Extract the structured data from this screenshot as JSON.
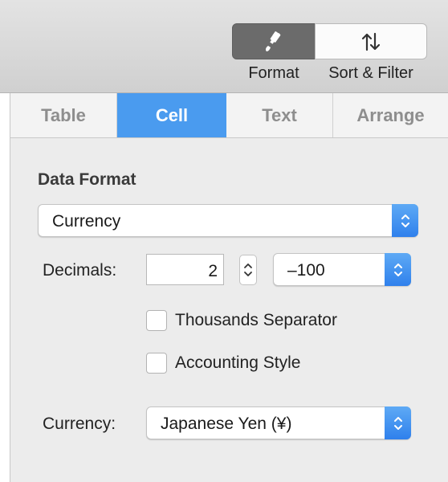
{
  "toolbar": {
    "format_label": "Format",
    "sort_filter_label": "Sort & Filter",
    "format_icon": "paintbrush-icon",
    "sort_icon": "sort-arrows-icon"
  },
  "tabs": [
    {
      "label": "Table"
    },
    {
      "label": "Cell",
      "selected": true
    },
    {
      "label": "Text"
    },
    {
      "label": "Arrange"
    }
  ],
  "panel": {
    "section_title": "Data Format",
    "data_format": {
      "selected": "Currency"
    },
    "decimals": {
      "label": "Decimals:",
      "value": "2"
    },
    "negative_format": {
      "selected": "–100"
    },
    "thousands_separator": {
      "label": "Thousands Separator",
      "checked": false
    },
    "accounting_style": {
      "label": "Accounting Style",
      "checked": false
    },
    "currency": {
      "label": "Currency:",
      "selected": "Japanese Yen (¥)"
    }
  },
  "colors": {
    "accent": "#4a9bef",
    "selected_segment": "#6b6b6b"
  }
}
